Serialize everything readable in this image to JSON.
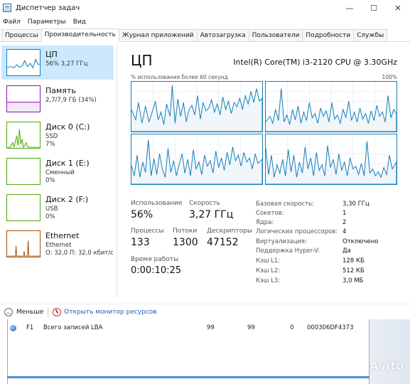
{
  "window": {
    "title": "Диспетчер задач",
    "controls": {
      "minimize": "—",
      "maximize": "☐",
      "close": "✕"
    }
  },
  "menu": [
    "Файл",
    "Параметры",
    "Вид"
  ],
  "tabs": [
    {
      "label": "Процессы",
      "active": false
    },
    {
      "label": "Производительность",
      "active": true
    },
    {
      "label": "Журнал приложений",
      "active": false
    },
    {
      "label": "Автозагрузка",
      "active": false
    },
    {
      "label": "Пользователи",
      "active": false
    },
    {
      "label": "Подробности",
      "active": false
    },
    {
      "label": "Службы",
      "active": false
    }
  ],
  "sidebar": {
    "items": [
      {
        "name": "ЦП",
        "line1": "56% 3,27 ГГц",
        "line2": "",
        "color": "#117dbb",
        "icon": "cpu-graph-icon",
        "selected": true
      },
      {
        "name": "Память",
        "line1": "2,7/7,9 ГБ (34%)",
        "line2": "",
        "color": "#8b12ae",
        "icon": "memory-graph-icon",
        "selected": false
      },
      {
        "name": "Диск 0 (C:)",
        "line1": "SSD",
        "line2": "7%",
        "color": "#4da60c",
        "icon": "disk-graph-icon",
        "selected": false
      },
      {
        "name": "Диск 1 (E:)",
        "line1": "Сменный",
        "line2": "0%",
        "color": "#4da60c",
        "icon": "disk-graph-icon",
        "selected": false
      },
      {
        "name": "Диск 2 (F:)",
        "line1": "USB",
        "line2": "0%",
        "color": "#4da60c",
        "icon": "disk-graph-icon",
        "selected": false
      },
      {
        "name": "Ethernet",
        "line1": "Ethernet",
        "line2": "О: 32,0 П: 32,0 кбит/с",
        "color": "#a74f01",
        "icon": "network-graph-icon",
        "selected": false
      }
    ]
  },
  "cpu": {
    "heading": "ЦП",
    "model": "Intel(R) Core(TM) i3-2120 CPU @ 3.30GHz",
    "graph_label": "% использования более 60 секунд",
    "graph_max": "100%",
    "stats": {
      "utilization_label": "Использование",
      "utilization_value": "56%",
      "speed_label": "Скорость",
      "speed_value": "3,27 ГГц",
      "processes_label": "Процессы",
      "processes_value": "133",
      "threads_label": "Потоки",
      "threads_value": "1300",
      "handles_label": "Дескрипторы",
      "handles_value": "47152",
      "uptime_label": "Время работы",
      "uptime_value": "0:00:10:25"
    },
    "specs": [
      {
        "key": "Базовая скорость:",
        "value": "3,30 ГГц"
      },
      {
        "key": "Сокетов:",
        "value": "1"
      },
      {
        "key": "Ядра:",
        "value": "2"
      },
      {
        "key": "Логических процессоров:",
        "value": "4"
      },
      {
        "key": "Виртуализация:",
        "value": "Отключено"
      },
      {
        "key": "Поддержка Hyper-V:",
        "value": "Да"
      },
      {
        "key": "Кэш L1:",
        "value": "128 КБ"
      },
      {
        "key": "Кэш L2:",
        "value": "512 КБ"
      },
      {
        "key": "Кэш L3:",
        "value": "3,0 МБ"
      }
    ],
    "colors": {
      "line": "#117dbb",
      "fill": "#f1f6fa",
      "grid": "#d9eaf4"
    }
  },
  "bottom": {
    "less_label": "Меньше",
    "monitor_link": "Открыть монитор ресурсов"
  },
  "background_row": {
    "col1": "F1",
    "col2": "Всего записей LBA",
    "col3": "99",
    "col4": "99",
    "col5": "0",
    "col6": "000306DF4373"
  },
  "watermark": "Avito"
}
